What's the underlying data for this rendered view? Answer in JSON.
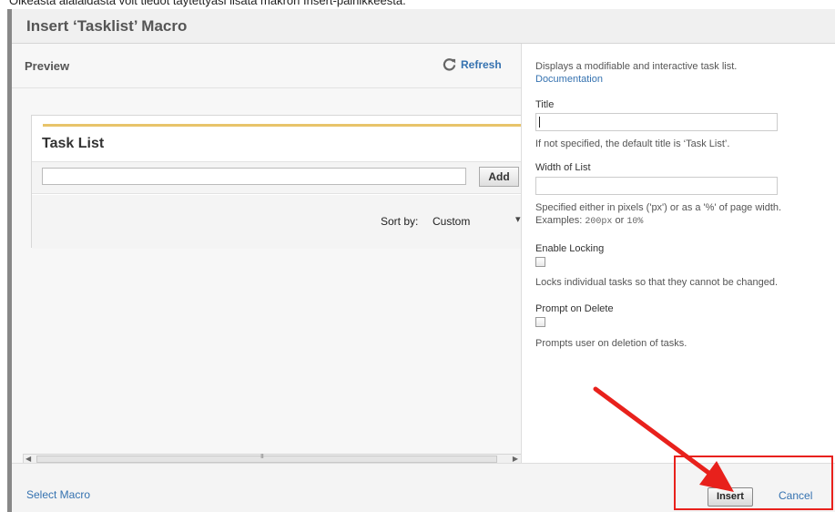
{
  "caption": "Oikeasta alalaidasta voit tiedot täytettyäsi lisätä makron Insert-painikkeesta.",
  "dialog": {
    "title": "Insert ‘Tasklist’ Macro"
  },
  "preview": {
    "label": "Preview",
    "refresh_label": "Refresh",
    "refresh_icon": "refresh-icon",
    "tasklist": {
      "title": "Task List",
      "add_label": "Add",
      "input_value": "",
      "sort_label": "Sort by:",
      "sort_value": "Custom"
    },
    "scrollbar_grip": "III"
  },
  "params": {
    "description": "Displays a modifiable and interactive task list.",
    "documentation_link": "Documentation",
    "title_label": "Title",
    "title_value": "",
    "title_help": "If not specified, the default title is ‘Task List’.",
    "width_label": "Width of List",
    "width_value": "",
    "width_help": "Specified either in pixels ('px') or as a '%' of page width.",
    "width_examples_prefix": "Examples:",
    "width_example_1": "200px",
    "width_examples_or": "or",
    "width_example_2": "10%",
    "locking_label": "Enable Locking",
    "locking_checked": false,
    "locking_help": "Locks individual tasks so that they cannot be changed.",
    "prompt_label": "Prompt on Delete",
    "prompt_checked": false,
    "prompt_help": "Prompts user on deletion of tasks."
  },
  "footer": {
    "select_macro": "Select Macro",
    "insert_label": "Insert",
    "cancel_label": "Cancel"
  },
  "colors": {
    "link": "#3572b0",
    "annotation": "#e8211c",
    "tasklist_stripe": "#e8c46a"
  }
}
